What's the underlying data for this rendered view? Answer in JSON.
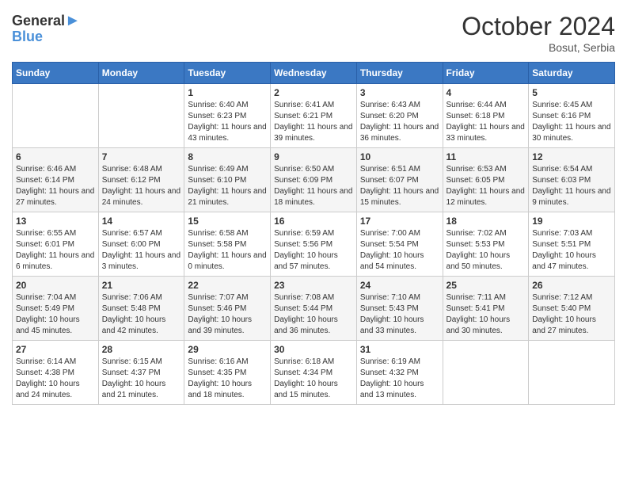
{
  "header": {
    "logo_line1": "General",
    "logo_line2": "Blue",
    "month_title": "October 2024",
    "location": "Bosut, Serbia"
  },
  "weekdays": [
    "Sunday",
    "Monday",
    "Tuesday",
    "Wednesday",
    "Thursday",
    "Friday",
    "Saturday"
  ],
  "days": [
    {
      "num": "",
      "info": ""
    },
    {
      "num": "",
      "info": ""
    },
    {
      "num": "1",
      "sunrise": "6:40 AM",
      "sunset": "6:23 PM",
      "daylight": "11 hours and 43 minutes."
    },
    {
      "num": "2",
      "sunrise": "6:41 AM",
      "sunset": "6:21 PM",
      "daylight": "11 hours and 39 minutes."
    },
    {
      "num": "3",
      "sunrise": "6:43 AM",
      "sunset": "6:20 PM",
      "daylight": "11 hours and 36 minutes."
    },
    {
      "num": "4",
      "sunrise": "6:44 AM",
      "sunset": "6:18 PM",
      "daylight": "11 hours and 33 minutes."
    },
    {
      "num": "5",
      "sunrise": "6:45 AM",
      "sunset": "6:16 PM",
      "daylight": "11 hours and 30 minutes."
    },
    {
      "num": "6",
      "sunrise": "6:46 AM",
      "sunset": "6:14 PM",
      "daylight": "11 hours and 27 minutes."
    },
    {
      "num": "7",
      "sunrise": "6:48 AM",
      "sunset": "6:12 PM",
      "daylight": "11 hours and 24 minutes."
    },
    {
      "num": "8",
      "sunrise": "6:49 AM",
      "sunset": "6:10 PM",
      "daylight": "11 hours and 21 minutes."
    },
    {
      "num": "9",
      "sunrise": "6:50 AM",
      "sunset": "6:09 PM",
      "daylight": "11 hours and 18 minutes."
    },
    {
      "num": "10",
      "sunrise": "6:51 AM",
      "sunset": "6:07 PM",
      "daylight": "11 hours and 15 minutes."
    },
    {
      "num": "11",
      "sunrise": "6:53 AM",
      "sunset": "6:05 PM",
      "daylight": "11 hours and 12 minutes."
    },
    {
      "num": "12",
      "sunrise": "6:54 AM",
      "sunset": "6:03 PM",
      "daylight": "11 hours and 9 minutes."
    },
    {
      "num": "13",
      "sunrise": "6:55 AM",
      "sunset": "6:01 PM",
      "daylight": "11 hours and 6 minutes."
    },
    {
      "num": "14",
      "sunrise": "6:57 AM",
      "sunset": "6:00 PM",
      "daylight": "11 hours and 3 minutes."
    },
    {
      "num": "15",
      "sunrise": "6:58 AM",
      "sunset": "5:58 PM",
      "daylight": "11 hours and 0 minutes."
    },
    {
      "num": "16",
      "sunrise": "6:59 AM",
      "sunset": "5:56 PM",
      "daylight": "10 hours and 57 minutes."
    },
    {
      "num": "17",
      "sunrise": "7:00 AM",
      "sunset": "5:54 PM",
      "daylight": "10 hours and 54 minutes."
    },
    {
      "num": "18",
      "sunrise": "7:02 AM",
      "sunset": "5:53 PM",
      "daylight": "10 hours and 50 minutes."
    },
    {
      "num": "19",
      "sunrise": "7:03 AM",
      "sunset": "5:51 PM",
      "daylight": "10 hours and 47 minutes."
    },
    {
      "num": "20",
      "sunrise": "7:04 AM",
      "sunset": "5:49 PM",
      "daylight": "10 hours and 45 minutes."
    },
    {
      "num": "21",
      "sunrise": "7:06 AM",
      "sunset": "5:48 PM",
      "daylight": "10 hours and 42 minutes."
    },
    {
      "num": "22",
      "sunrise": "7:07 AM",
      "sunset": "5:46 PM",
      "daylight": "10 hours and 39 minutes."
    },
    {
      "num": "23",
      "sunrise": "7:08 AM",
      "sunset": "5:44 PM",
      "daylight": "10 hours and 36 minutes."
    },
    {
      "num": "24",
      "sunrise": "7:10 AM",
      "sunset": "5:43 PM",
      "daylight": "10 hours and 33 minutes."
    },
    {
      "num": "25",
      "sunrise": "7:11 AM",
      "sunset": "5:41 PM",
      "daylight": "10 hours and 30 minutes."
    },
    {
      "num": "26",
      "sunrise": "7:12 AM",
      "sunset": "5:40 PM",
      "daylight": "10 hours and 27 minutes."
    },
    {
      "num": "27",
      "sunrise": "6:14 AM",
      "sunset": "4:38 PM",
      "daylight": "10 hours and 24 minutes."
    },
    {
      "num": "28",
      "sunrise": "6:15 AM",
      "sunset": "4:37 PM",
      "daylight": "10 hours and 21 minutes."
    },
    {
      "num": "29",
      "sunrise": "6:16 AM",
      "sunset": "4:35 PM",
      "daylight": "10 hours and 18 minutes."
    },
    {
      "num": "30",
      "sunrise": "6:18 AM",
      "sunset": "4:34 PM",
      "daylight": "10 hours and 15 minutes."
    },
    {
      "num": "31",
      "sunrise": "6:19 AM",
      "sunset": "4:32 PM",
      "daylight": "10 hours and 13 minutes."
    },
    {
      "num": "",
      "info": ""
    },
    {
      "num": "",
      "info": ""
    }
  ]
}
